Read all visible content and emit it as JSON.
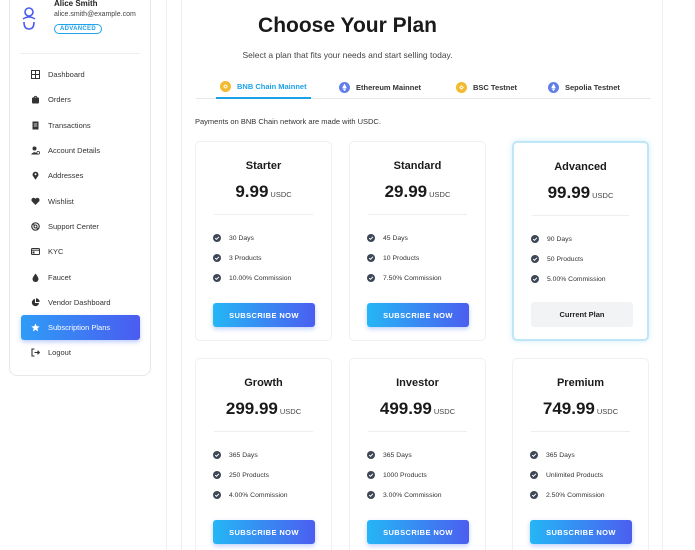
{
  "profile": {
    "name": "Alice Smith",
    "email": "alice.smith@example.com",
    "tier": "ADVANCED"
  },
  "sidebar": {
    "items": [
      {
        "label": "Dashboard",
        "icon": "grid-icon"
      },
      {
        "label": "Orders",
        "icon": "bag-icon"
      },
      {
        "label": "Transactions",
        "icon": "receipt-icon"
      },
      {
        "label": "Account Details",
        "icon": "user-cog-icon"
      },
      {
        "label": "Addresses",
        "icon": "map-pin-icon"
      },
      {
        "label": "Wishlist",
        "icon": "heart-icon"
      },
      {
        "label": "Support Center",
        "icon": "lifebuoy-icon"
      },
      {
        "label": "KYC",
        "icon": "id-card-icon"
      },
      {
        "label": "Faucet",
        "icon": "drop-icon"
      },
      {
        "label": "Vendor Dashboard",
        "icon": "pie-chart-icon"
      },
      {
        "label": "Subscription Plans",
        "icon": "star-icon",
        "active": true
      },
      {
        "label": "Logout",
        "icon": "logout-icon"
      }
    ]
  },
  "header": {
    "title": "Choose Your Plan",
    "subtitle": "Select a plan that fits your needs and start selling today."
  },
  "tabs": [
    {
      "label": "BNB Chain Mainnet",
      "icon": "bnb-coin-icon",
      "active": true
    },
    {
      "label": "Ethereum Mainnet",
      "icon": "eth-coin-icon"
    },
    {
      "label": "BSC Testnet",
      "icon": "bnb-coin-icon"
    },
    {
      "label": "Sepolia Testnet",
      "icon": "eth-coin-icon"
    }
  ],
  "network_note": "Payments on BNB Chain network are made with USDC.",
  "plans": [
    {
      "name": "Starter",
      "price": "9.99",
      "currency": "USDC",
      "features": [
        "30 Days",
        "3 Products",
        "10.00% Commission"
      ],
      "action": "SUBSCRIBE NOW"
    },
    {
      "name": "Standard",
      "price": "29.99",
      "currency": "USDC",
      "features": [
        "45 Days",
        "10 Products",
        "7.50% Commission"
      ],
      "action": "SUBSCRIBE NOW"
    },
    {
      "name": "Advanced",
      "price": "99.99",
      "currency": "USDC",
      "features": [
        "90 Days",
        "50 Products",
        "5.00% Commission"
      ],
      "action": "Current Plan",
      "current": true
    },
    {
      "name": "Growth",
      "price": "299.99",
      "currency": "USDC",
      "features": [
        "365 Days",
        "250 Products",
        "4.00% Commission"
      ],
      "action": "SUBSCRIBE NOW"
    },
    {
      "name": "Investor",
      "price": "499.99",
      "currency": "USDC",
      "features": [
        "365 Days",
        "1000 Products",
        "3.00% Commission"
      ],
      "action": "SUBSCRIBE NOW"
    },
    {
      "name": "Premium",
      "price": "749.99",
      "currency": "USDC",
      "features": [
        "365 Days",
        "Unlimited Products",
        "2.50% Commission"
      ],
      "action": "SUBSCRIBE NOW"
    }
  ],
  "colors": {
    "accent": "#1ba1e8",
    "gradient_start": "#25b6f5",
    "gradient_end": "#4b5ef0",
    "bnb": "#f3ba2f",
    "eth": "#627eea",
    "check": "#3d4756"
  }
}
